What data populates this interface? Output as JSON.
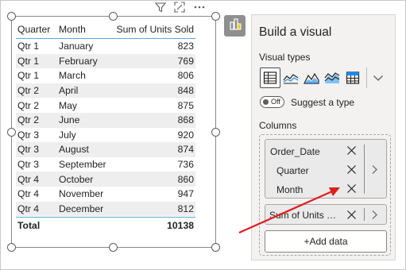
{
  "table": {
    "headers": [
      "Quarter",
      "Month",
      "Sum of Units Sold"
    ],
    "rows": [
      [
        "Qtr 1",
        "January",
        "823"
      ],
      [
        "Qtr 1",
        "February",
        "769"
      ],
      [
        "Qtr 1",
        "March",
        "806"
      ],
      [
        "Qtr 2",
        "April",
        "848"
      ],
      [
        "Qtr 2",
        "May",
        "875"
      ],
      [
        "Qtr 2",
        "June",
        "868"
      ],
      [
        "Qtr 3",
        "July",
        "920"
      ],
      [
        "Qtr 3",
        "August",
        "874"
      ],
      [
        "Qtr 3",
        "September",
        "736"
      ],
      [
        "Qtr 4",
        "October",
        "860"
      ],
      [
        "Qtr 4",
        "November",
        "947"
      ],
      [
        "Qtr 4",
        "December",
        "812"
      ]
    ],
    "total_label": "Total",
    "total_value": "10138"
  },
  "visual_header_icons": [
    "filter-icon",
    "focus-mode-icon",
    "more-options-icon"
  ],
  "pane": {
    "title": "Build a visual",
    "visual_types_label": "Visual types",
    "visual_types": [
      "table-icon",
      "line-chart-icon",
      "area-chart-icon",
      "stacked-area-chart-icon",
      "matrix-icon"
    ],
    "suggest_toggle_state": "Off",
    "suggest_label": "Suggest a type",
    "columns_label": "Columns",
    "hierarchy": {
      "name": "Order_Date",
      "levels": [
        "Quarter",
        "Month"
      ]
    },
    "measure_field": "Sum of Units Sold",
    "add_data_label": "+Add data"
  },
  "colors": {
    "accent_line": "#5aa8dc",
    "annotation_arrow": "#e01e1e",
    "pane_background": "#f3f2f1"
  }
}
